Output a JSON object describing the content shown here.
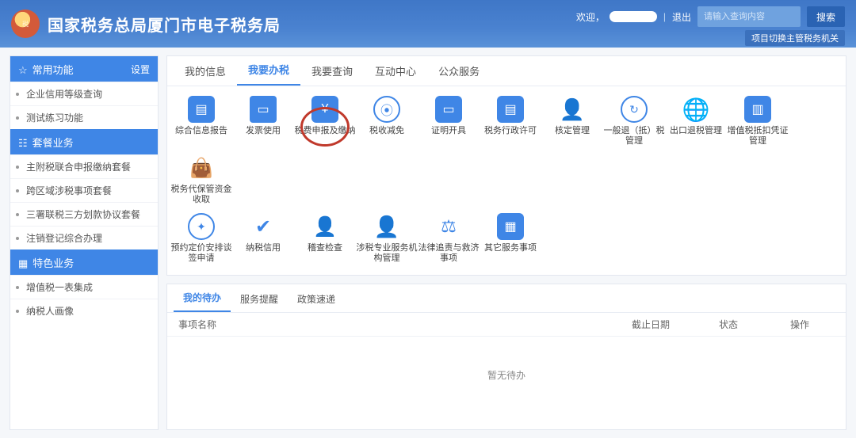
{
  "header": {
    "site_title": "国家税务总局厦门市电子税务局",
    "search_placeholder": "请输入查询内容",
    "search_btn": "搜索",
    "welcome": "欢迎，",
    "logout": "退出",
    "switch_org": "项目切换主管税务机关"
  },
  "sidebar": {
    "sec1": {
      "title": "常用功能",
      "setting": "设置",
      "items": [
        "企业信用等级查询",
        "测试练习功能"
      ]
    },
    "sec2": {
      "title": "套餐业务",
      "items": [
        "主附税联合申报缴纳套餐",
        "跨区域涉税事项套餐",
        "三署联税三方划款协议套餐",
        "注销登记综合办理"
      ]
    },
    "sec3": {
      "title": "特色业务",
      "items": [
        "增值税一表集成",
        "纳税人画像"
      ]
    }
  },
  "tabs_top": [
    "我的信息",
    "我要办税",
    "我要查询",
    "互动中心",
    "公众服务"
  ],
  "grid": {
    "row1": [
      {
        "k": "doc",
        "label": "综合信息报告"
      },
      {
        "k": "ticket",
        "label": "发票使用"
      },
      {
        "k": "wallet",
        "label": "税费申报及缴纳",
        "hl": true
      },
      {
        "k": "coin",
        "label": "税收减免"
      },
      {
        "k": "ticket2",
        "label": "证明开具"
      },
      {
        "k": "doc",
        "label": "税务行政许可"
      },
      {
        "k": "user",
        "label": "核定管理"
      },
      {
        "k": "refresh",
        "label": "一般退（抵）税管理"
      },
      {
        "k": "globe",
        "label": "出口退税管理"
      },
      {
        "k": "book",
        "label": "增值税抵扣凭证管理"
      },
      {
        "k": "bag",
        "label": "税务代保管资金收取"
      }
    ],
    "row2": [
      {
        "k": "compass",
        "label": "预约定价安排谈签申请"
      },
      {
        "k": "shield",
        "label": "纳税信用"
      },
      {
        "k": "person",
        "label": "稽查检查"
      },
      {
        "k": "user",
        "label": "涉税专业服务机构管理"
      },
      {
        "k": "gavel",
        "label": "法律追责与救济事项"
      },
      {
        "k": "cal",
        "label": "其它服务事项"
      }
    ]
  },
  "tabs_low": [
    "我的待办",
    "服务提醒",
    "政策速递"
  ],
  "table": {
    "col_name": "事项名称",
    "col_date": "截止日期",
    "col_status": "状态",
    "col_op": "操作",
    "empty": "暂无待办"
  }
}
